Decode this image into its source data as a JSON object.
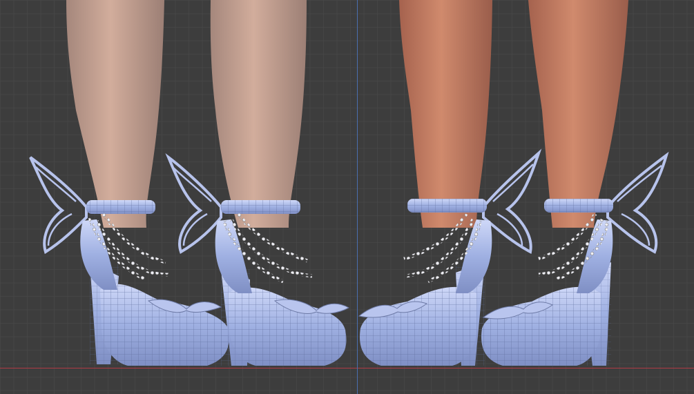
{
  "viewport": {
    "background_color": "#3d3d3d",
    "grid_color": "#464646",
    "x_axis_color": "#b23b45",
    "z_axis_color": "#4a6fb0"
  },
  "scene": {
    "subjects": [
      "light-skin-legs",
      "tan-skin-legs"
    ],
    "object": "butterfly-wing-platform-heels",
    "shoe_color": "#a9b8e8",
    "wireframe_color": "#6d7aa6",
    "chain_color": "#e6e6ee",
    "light_skin_color": "#c9a28f",
    "tan_skin_color": "#c47e63",
    "display_mode": "solid-with-wireframe-overlay"
  }
}
